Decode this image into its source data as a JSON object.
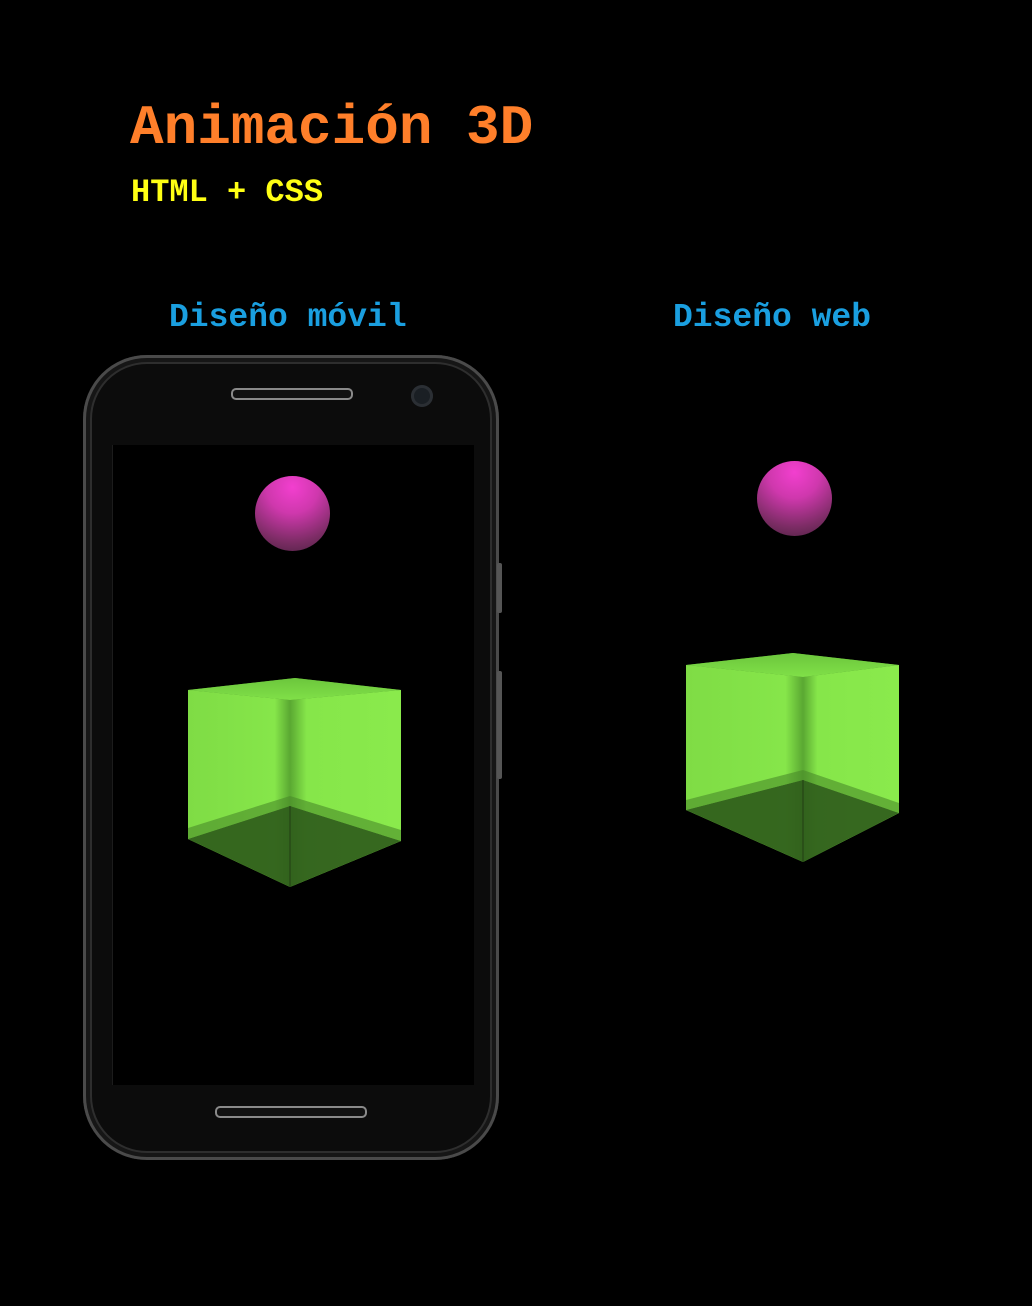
{
  "header": {
    "title": "Animación 3D",
    "subtitle": "HTML + CSS"
  },
  "sections": {
    "mobile_label": "Diseño móvil",
    "web_label": "Diseño web"
  },
  "colors": {
    "background": "#000000",
    "title": "#ff7f2a",
    "subtitle": "#ffff14",
    "section_label": "#1a9fe0",
    "sphere": "#e040c0",
    "cube": "#88e84a"
  },
  "icons": {
    "phone": "phone-frame",
    "sphere": "sphere-shape",
    "cube": "cube-shape"
  }
}
